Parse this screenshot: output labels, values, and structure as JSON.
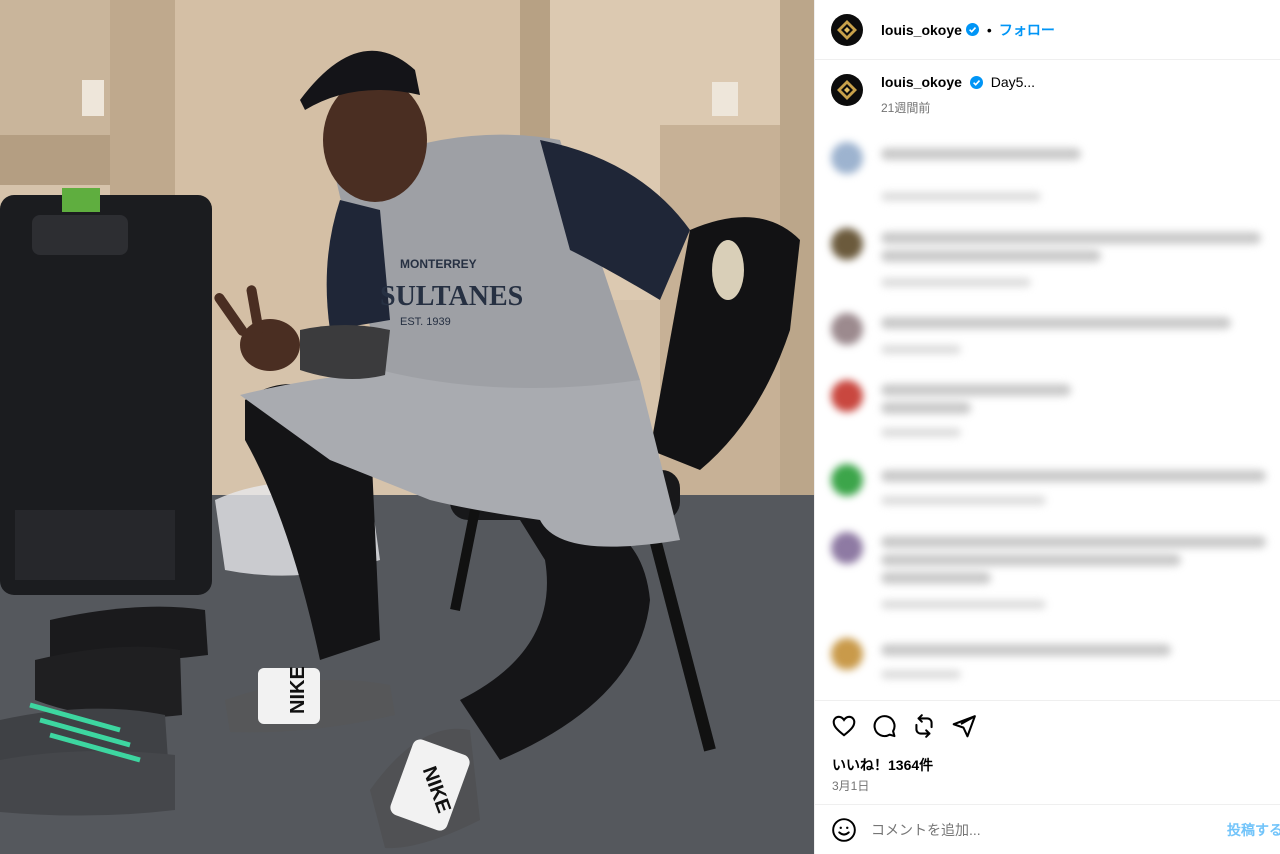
{
  "post": {
    "username": "louis_okoye",
    "separator": "•",
    "follow_label": "フォロー",
    "caption_text": "Day5...",
    "caption_time": "21週間前",
    "likes": "いいね！1364件",
    "date": "3月1日"
  },
  "comment_box": {
    "placeholder": "コメントを追加...",
    "post_label": "投稿する"
  },
  "photo": {
    "jersey_top": "MONTERREY",
    "jersey_main": "SULTANES",
    "jersey_est": "EST. 1939",
    "slide_brand": "NIKE"
  },
  "icons": {
    "avatar": "gold-diamond-logo-icon",
    "verified": "verified-badge-icon",
    "like": "heart-icon",
    "comment": "comment-bubble-icon",
    "share": "repost-icon",
    "send": "paper-plane-icon",
    "emoji": "smiley-icon"
  },
  "colors": {
    "accent": "#0095f6",
    "muted": "#737373",
    "border": "#efefef"
  }
}
